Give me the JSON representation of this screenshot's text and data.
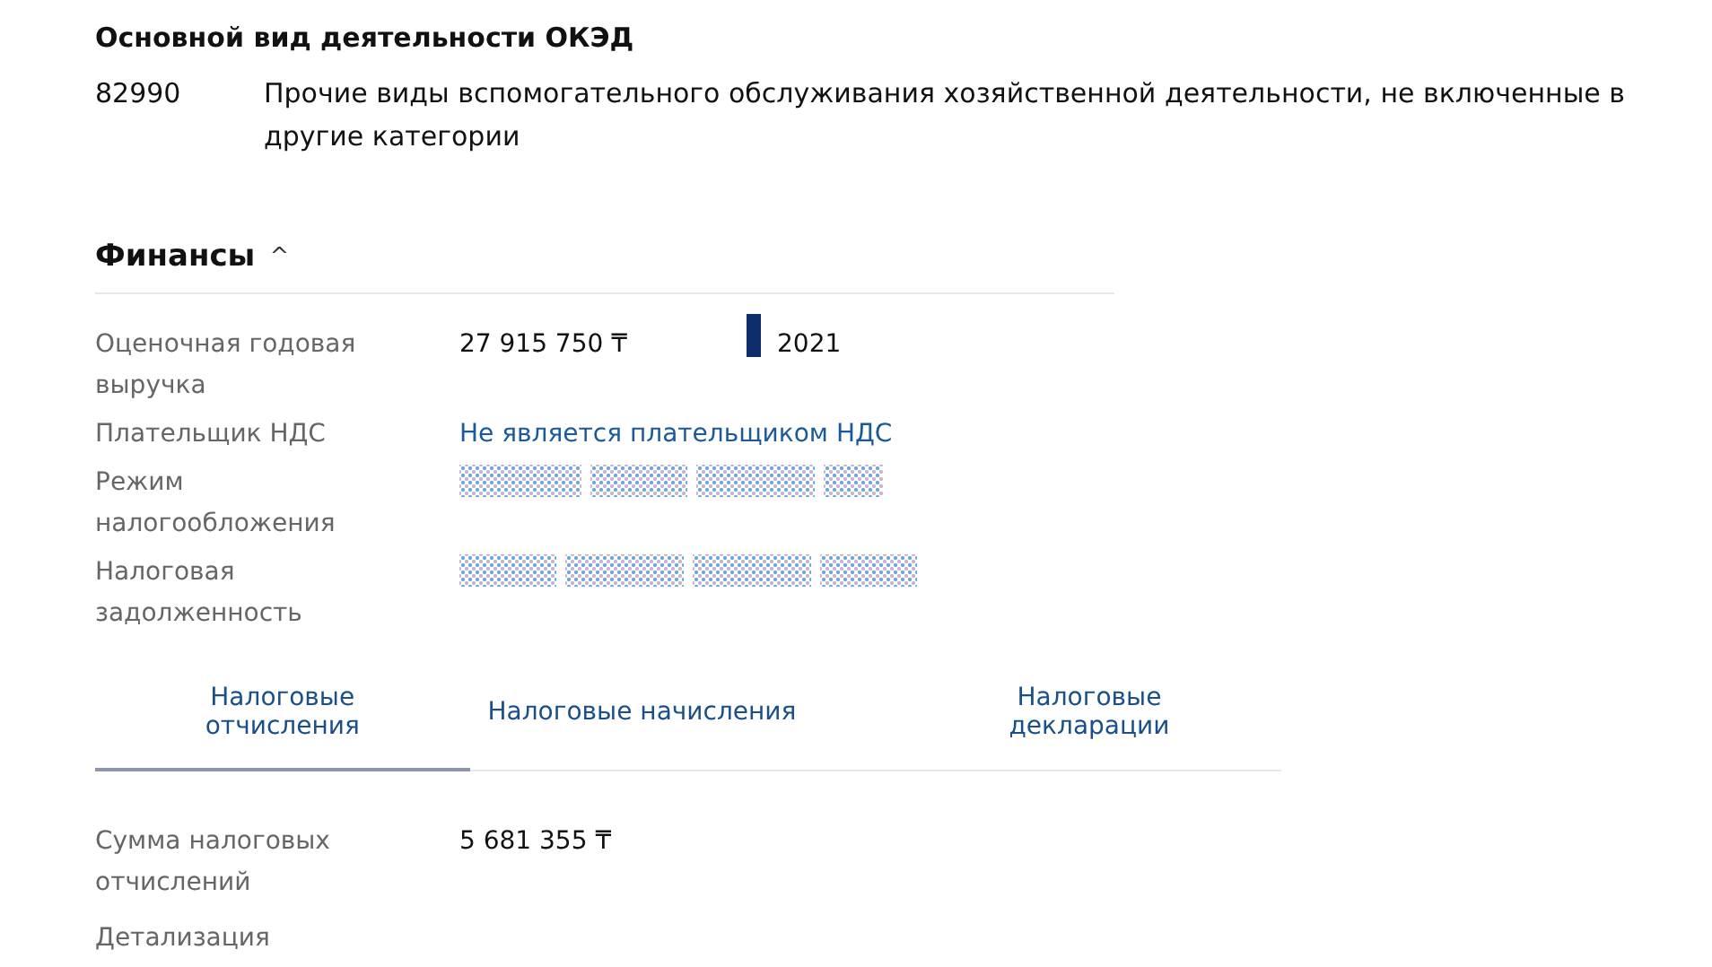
{
  "okved": {
    "title": "Основной вид деятельности ОКЭД",
    "code": "82990",
    "description": "Прочие виды вспомогательного обслуживания хозяйственной деятельности, не включенные в другие категории"
  },
  "finance": {
    "title": "Финансы",
    "toggle": "^",
    "expanded": true,
    "rows": [
      {
        "kind": "revenue",
        "label": "Оценочная годовая выручка",
        "value": "27 915 750 ₸",
        "year": "2021"
      },
      {
        "kind": "link",
        "label": "Плательщик НДС",
        "value": "Не является плательщиком НДС"
      },
      {
        "kind": "masked",
        "label": "Режим налогообложения"
      },
      {
        "kind": "masked",
        "label": "Налоговая задолженность"
      }
    ]
  },
  "tabs": [
    {
      "label": "Налоговые отчисления",
      "selected": true
    },
    {
      "label": "Налоговые начисления",
      "selected": false
    },
    {
      "label": "Налоговые декларации",
      "selected": false
    }
  ],
  "tax_rows": [
    {
      "kind": "text",
      "label": "Сумма налоговых отчислений",
      "value": "5 681 355 ₸"
    },
    {
      "kind": "label",
      "label": "Детализация"
    }
  ]
}
